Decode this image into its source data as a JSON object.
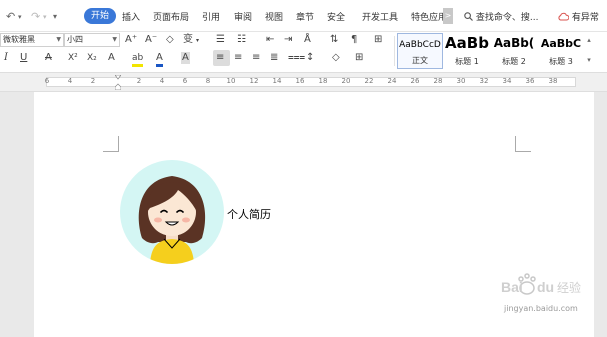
{
  "menubar": {
    "quick_undo": "↶",
    "quick_redo": "↷",
    "quick_dropdown": "▾",
    "tabs": [
      "开始",
      "插入",
      "页面布局",
      "引用",
      "审阅",
      "视图",
      "章节",
      "安全",
      "开发工具",
      "特色应用"
    ],
    "more": ">",
    "search_label": "查找命令、搜...",
    "issue_label": "有异常"
  },
  "toolbar": {
    "font_name": "微软雅黑",
    "font_size": "小四",
    "grow_font": "A⁺",
    "shrink_font": "A⁻",
    "clear_format": "◇",
    "pinyin": "变",
    "italic": "I",
    "underline": "U",
    "strike": "A",
    "superscript": "X²",
    "subscript": "X₂",
    "text_effect": "A",
    "highlight": "ab",
    "font_color": "A",
    "char_shading": "A",
    "accent_color": "#3a78d8",
    "highlight_color": "#f2e500",
    "font_color_bar": "#1a56c4"
  },
  "styles": [
    {
      "sample": "AaBbCcD",
      "name": "正文"
    },
    {
      "sample": "AaBb",
      "name": "标题 1"
    },
    {
      "sample": "AaBb(",
      "name": "标题 2"
    },
    {
      "sample": "AaBbC",
      "name": "标题 3"
    }
  ],
  "ruler": {
    "numbers": [
      "6",
      "4",
      "2",
      "2",
      "4",
      "6",
      "8",
      "10",
      "12",
      "14",
      "16",
      "18",
      "20",
      "22",
      "24",
      "26",
      "28",
      "30",
      "32",
      "34",
      "36",
      "38"
    ]
  },
  "document": {
    "title": "个人简历"
  },
  "watermark": {
    "site": "jingyan.baidu.com"
  }
}
